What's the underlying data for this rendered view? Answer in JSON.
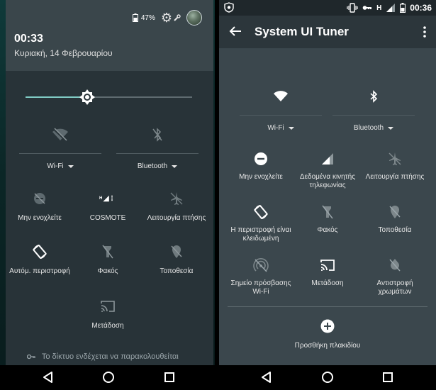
{
  "left": {
    "status": {
      "battery": "47%"
    },
    "time": "00:33",
    "date": "Κυριακή, 14 Φεβρουαρίου",
    "brightness": 0.37,
    "wifi_label": "Wi-Fi",
    "bluetooth_label": "Bluetooth",
    "tiles": [
      {
        "label": "Μην ενοχλείτε",
        "icon": "do-not-disturb-off-icon"
      },
      {
        "label": "COSMOTE",
        "icon": "cellular-signal-icon"
      },
      {
        "label": "Λειτουργία πτήσης",
        "icon": "airplane-icon"
      },
      {
        "label": "Αυτόμ. περιστροφή",
        "icon": "auto-rotate-icon"
      },
      {
        "label": "Φακός",
        "icon": "flashlight-off-icon"
      },
      {
        "label": "Τοποθεσία",
        "icon": "location-off-icon"
      },
      {
        "label": "Μετάδοση",
        "icon": "cast-icon"
      }
    ],
    "footer": "Το δίκτυο ενδέχεται να παρακολουθείται"
  },
  "right": {
    "status": {
      "network": "H",
      "time": "00:36"
    },
    "title": "System UI Tuner",
    "wifi_label": "Wi-Fi",
    "bluetooth_label": "Bluetooth",
    "tiles": [
      {
        "label": "Μην ενοχλείτε",
        "icon": "do-not-disturb-icon"
      },
      {
        "label": "Δεδομένα κινητής τηλεφωνίας",
        "icon": "mobile-data-icon"
      },
      {
        "label": "Λειτουργία πτήσης",
        "icon": "airplane-icon"
      },
      {
        "label": "Η περιστροφή είναι κλειδωμένη",
        "icon": "rotation-lock-icon"
      },
      {
        "label": "Φακός",
        "icon": "flashlight-off-icon"
      },
      {
        "label": "Τοποθεσία",
        "icon": "location-off-icon"
      },
      {
        "label": "Σημείο πρόσβασης Wi-Fi",
        "icon": "hotspot-icon"
      },
      {
        "label": "Μετάδοση",
        "icon": "cast-icon"
      },
      {
        "label": "Αντιστροφή χρωμάτων",
        "icon": "invert-colors-icon"
      }
    ],
    "add_tile_label": "Προσθήκη πλακιδίου"
  },
  "colors": {
    "accent": "#80cbc4",
    "panel": "#283338",
    "tuner_bg": "#3b474d"
  }
}
